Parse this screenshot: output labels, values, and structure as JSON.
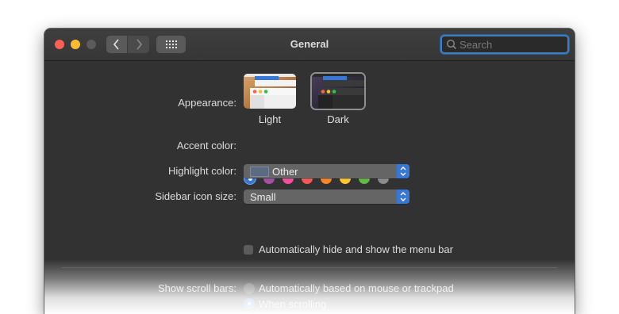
{
  "window": {
    "title": "General"
  },
  "toolbar": {
    "back_icon": "chevron-left-icon",
    "forward_icon": "chevron-right-icon",
    "grid_icon": "grid-icon"
  },
  "search": {
    "placeholder": "Search",
    "value": ""
  },
  "appearance": {
    "label": "Appearance:",
    "options": [
      {
        "label": "Light"
      },
      {
        "label": "Dark"
      }
    ]
  },
  "accent": {
    "label": "Accent color:",
    "colors": [
      "#3677d8",
      "#a550a7",
      "#f74f9e",
      "#fc5753",
      "#fd8523",
      "#ffc62f",
      "#62ba46",
      "#8c8c8c"
    ]
  },
  "highlight": {
    "label": "Highlight color:",
    "value": "Other"
  },
  "sidebar_icon": {
    "label": "Sidebar icon size:",
    "value": "Small"
  },
  "menubar": {
    "label": "Automatically hide and show the menu bar"
  },
  "scrollbars": {
    "label": "Show scroll bars:",
    "options": [
      {
        "label": "Automatically based on mouse or trackpad"
      },
      {
        "label": "When scrolling"
      }
    ]
  }
}
